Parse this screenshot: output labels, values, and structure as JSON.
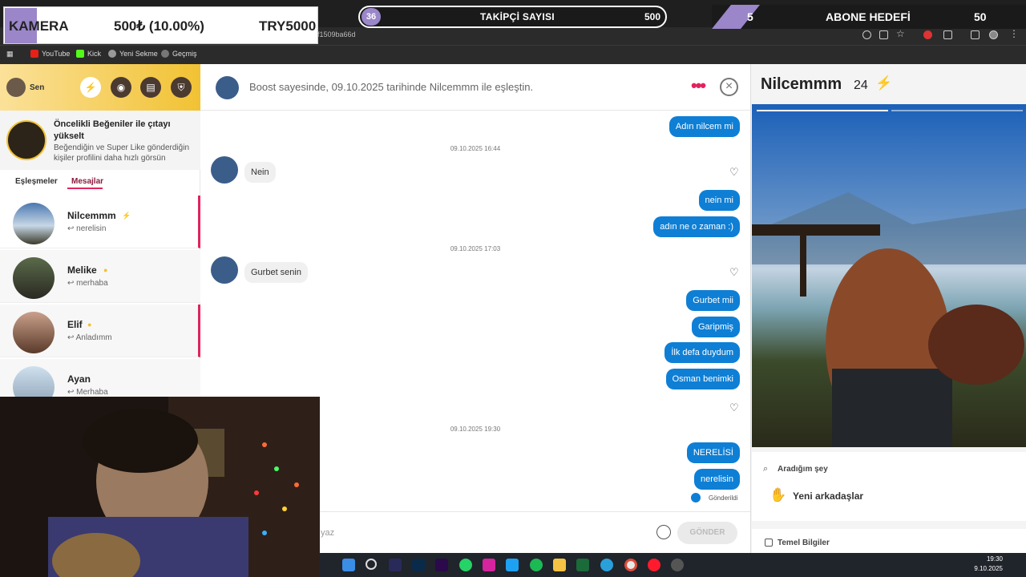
{
  "browser": {
    "url_fragment": "f1509ba66d",
    "bookmarks": [
      "YouTube",
      "Kick",
      "Yeni Sekme",
      "Geçmiş"
    ]
  },
  "overlays": {
    "kamera_label": "KAMERA",
    "kamera_amount": "500₺ (10.00%)",
    "kamera_goal": "TRY5000",
    "takipci_count": "36",
    "takipci_label": "TAKİPÇİ SAYISI",
    "takipci_goal": "500",
    "abone_count": "5",
    "abone_label": "ABONE HEDEFİ",
    "abone_goal": "50"
  },
  "sidebar": {
    "user_name": "Sen",
    "promo_title": "Öncelikli Beğeniler ile çıtayı yükselt",
    "promo_desc": "Beğendiğin ve Super Like gönderdiğin kişiler profilini daha hızlı görsün",
    "tabs": [
      "Eşleşmeler",
      "Mesajlar"
    ],
    "conversations": [
      {
        "name": "Nilcemmm",
        "preview": "↩ nerelisin",
        "badge": "boost"
      },
      {
        "name": "Melike",
        "preview": "↩ merhaba",
        "badge": "gold"
      },
      {
        "name": "Elif",
        "preview": "↩ Anladımm",
        "badge": "gold"
      },
      {
        "name": "Ayan",
        "preview": "↩ Merhaba",
        "badge": ""
      }
    ]
  },
  "chat": {
    "header_text": "Boost sayesinde, 09.10.2025 tarihinde Nilcemmm ile eşleştin.",
    "messages": {
      "m1": "Adın nilcem mi",
      "d1": "09.10.2025 16:44",
      "m2": "Nein",
      "m3": "nein mi",
      "m4": "adın ne o zaman :)",
      "d2": "09.10.2025 17:03",
      "m5": "Gurbet senin",
      "m6": "Gurbet mii",
      "m7": "Garipmiş",
      "m8": "İlk defa duydum",
      "m9": "Osman benimki",
      "d3": "09.10.2025 19:30",
      "m10": "NERELİSİ",
      "m11": "nerelisin"
    },
    "sent_label": "Gönderildi",
    "compose_placeholder": "yaz",
    "send_label": "GÖNDER"
  },
  "profile": {
    "name": "Nilcemmm",
    "age": "24",
    "looking_for_label": "Aradığım şey",
    "looking_for_value": "Yeni arkadaşlar",
    "basics_label": "Temel Bilgiler"
  },
  "taskbar": {
    "time": "19:30",
    "date": "9.10.2025"
  }
}
